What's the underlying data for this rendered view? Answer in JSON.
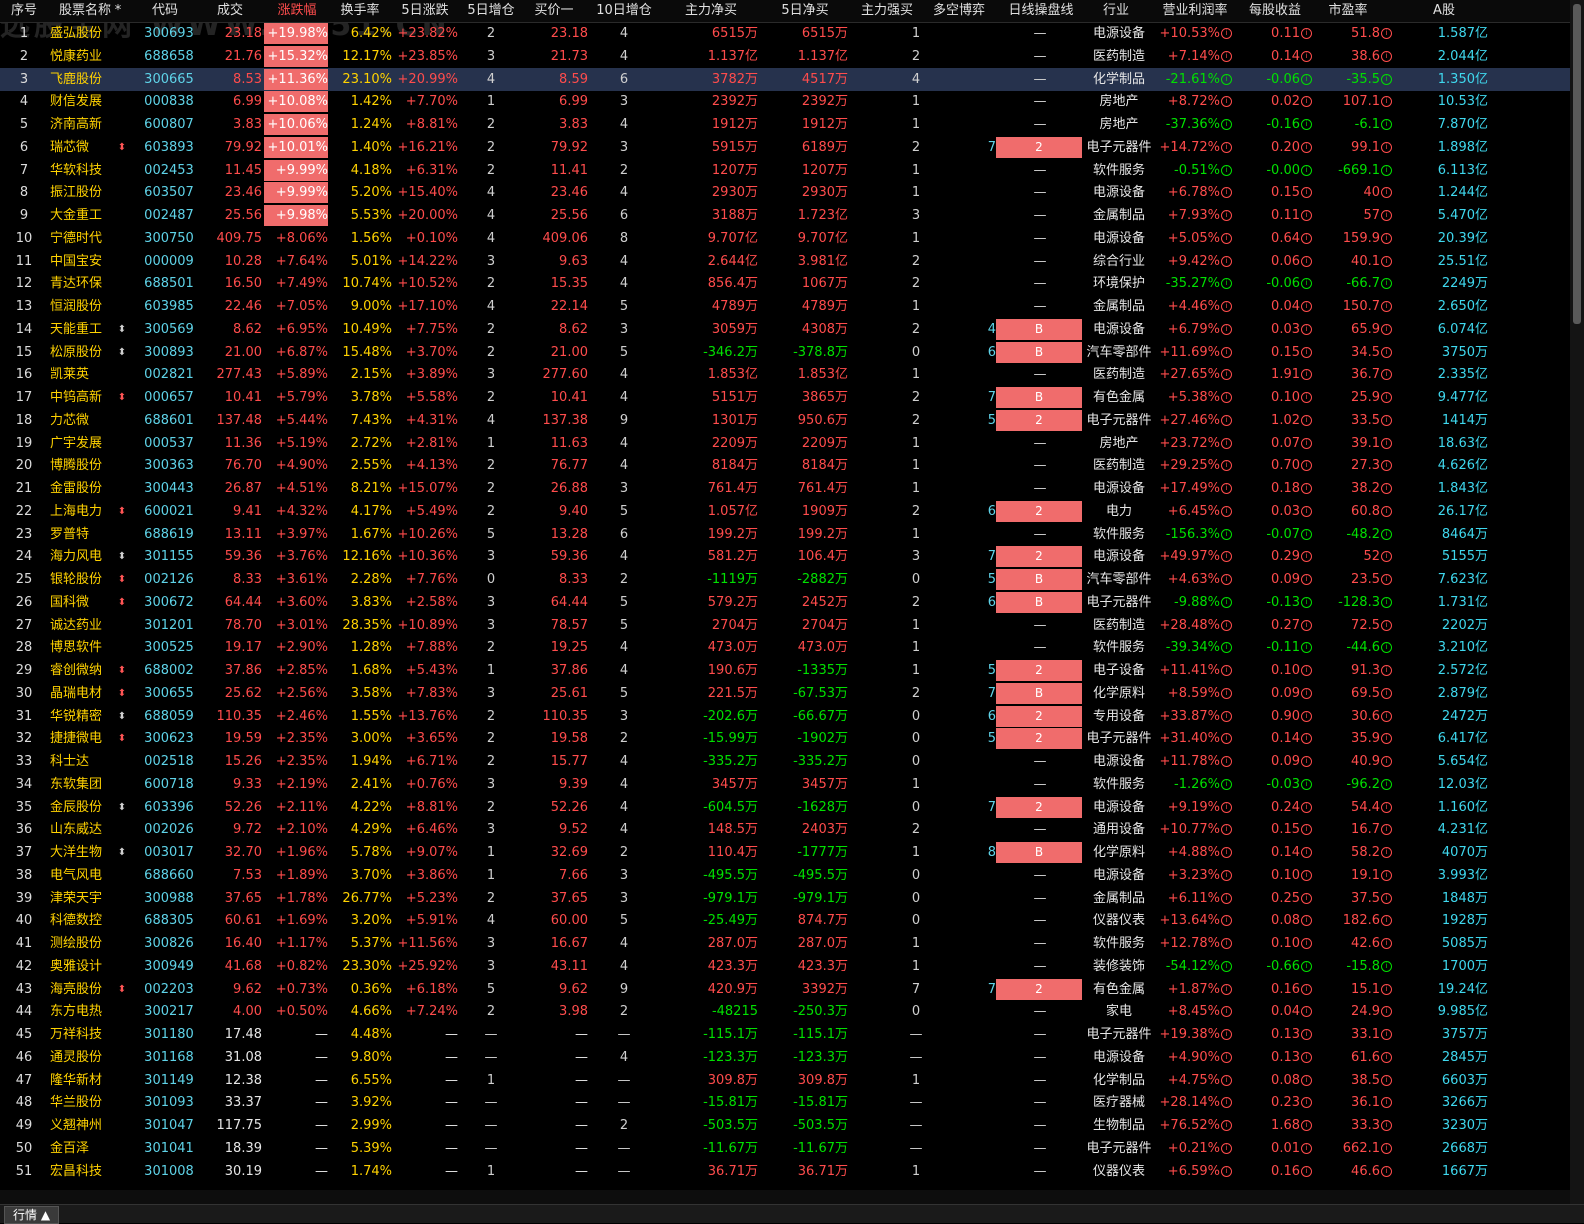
{
  "watermark": "选股宝网 WWW.XG51.CN",
  "tab_label": "行情 ▲",
  "sorted_column": "涨跌幅",
  "headers": [
    "序号",
    "股票名称",
    "*",
    "代码",
    "成交",
    "涨跌幅",
    "换手率",
    "5日涨跌",
    "5日增仓",
    "买价一",
    "10日增仓",
    "主力净买",
    "5日净买",
    "主力强买",
    "多空博弈",
    "日线操盘线",
    "行业",
    "营业利润率",
    "每股收益",
    "市盈率",
    "A股"
  ],
  "rows": [
    [
      "1",
      "盛弘股份",
      "",
      "300693",
      "23.18",
      "+19.98%",
      "6.42%",
      "+23.82%",
      "2",
      "23.18",
      "4",
      "6515万",
      "6515万",
      "1",
      "",
      "",
      "—",
      "电源设备",
      "+10.53%",
      "0.11",
      "51.8",
      "1.587亿"
    ],
    [
      "2",
      "悦康药业",
      "",
      "688658",
      "21.76",
      "+15.32%",
      "12.17%",
      "+23.85%",
      "3",
      "21.73",
      "4",
      "1.137亿",
      "1.137亿",
      "2",
      "",
      "",
      "—",
      "医药制造",
      "+7.14%",
      "0.14",
      "38.6",
      "2.044亿"
    ],
    [
      "3",
      "飞鹿股份",
      "",
      "300665",
      "8.53",
      "+11.36%",
      "23.10%",
      "+20.99%",
      "4",
      "8.59",
      "6",
      "3782万",
      "4517万",
      "4",
      "",
      "",
      "—",
      "化学制品",
      "-21.61%",
      "-0.06",
      "-35.5",
      "1.350亿"
    ],
    [
      "4",
      "财信发展",
      "",
      "000838",
      "6.99",
      "+10.08%",
      "1.42%",
      "+7.70%",
      "1",
      "6.99",
      "3",
      "2392万",
      "2392万",
      "1",
      "",
      "",
      "—",
      "房地产",
      "+8.72%",
      "0.02",
      "107.1",
      "10.53亿"
    ],
    [
      "5",
      "济南高新",
      "",
      "600807",
      "3.83",
      "+10.06%",
      "1.24%",
      "+8.81%",
      "2",
      "3.83",
      "4",
      "1912万",
      "1912万",
      "1",
      "",
      "",
      "—",
      "房地产",
      "-37.36%",
      "-0.16",
      "-6.1",
      "7.870亿"
    ],
    [
      "6",
      "瑞芯微",
      "r",
      "603893",
      "79.92",
      "+10.01%",
      "1.40%",
      "+16.21%",
      "2",
      "79.92",
      "3",
      "5915万",
      "6189万",
      "2",
      "7",
      "2",
      "",
      "电子元器件",
      "+14.72%",
      "0.20",
      "99.1",
      "1.898亿"
    ],
    [
      "7",
      "华软科技",
      "",
      "002453",
      "11.45",
      "+9.99%",
      "4.18%",
      "+6.31%",
      "2",
      "11.41",
      "2",
      "1207万",
      "1207万",
      "1",
      "",
      "",
      "—",
      "软件服务",
      "-0.51%",
      "-0.00",
      "-669.1",
      "6.113亿"
    ],
    [
      "8",
      "振江股份",
      "",
      "603507",
      "23.46",
      "+9.99%",
      "5.20%",
      "+15.40%",
      "4",
      "23.46",
      "4",
      "2930万",
      "2930万",
      "1",
      "",
      "",
      "—",
      "电源设备",
      "+6.78%",
      "0.15",
      "40",
      "1.244亿"
    ],
    [
      "9",
      "大金重工",
      "",
      "002487",
      "25.56",
      "+9.98%",
      "5.53%",
      "+20.00%",
      "4",
      "25.56",
      "6",
      "3188万",
      "1.723亿",
      "3",
      "",
      "",
      "—",
      "金属制品",
      "+7.93%",
      "0.11",
      "57",
      "5.470亿"
    ],
    [
      "10",
      "宁德时代",
      "",
      "300750",
      "409.75",
      "+8.06%",
      "1.56%",
      "+0.10%",
      "4",
      "409.06",
      "8",
      "9.707亿",
      "9.707亿",
      "1",
      "",
      "",
      "—",
      "电源设备",
      "+5.05%",
      "0.64",
      "159.9",
      "20.39亿"
    ],
    [
      "11",
      "中国宝安",
      "",
      "000009",
      "10.28",
      "+7.64%",
      "5.01%",
      "+14.22%",
      "3",
      "9.63",
      "4",
      "2.644亿",
      "3.981亿",
      "2",
      "",
      "",
      "—",
      "综合行业",
      "+9.42%",
      "0.06",
      "40.1",
      "25.51亿"
    ],
    [
      "12",
      "青达环保",
      "",
      "688501",
      "16.50",
      "+7.49%",
      "10.74%",
      "+10.52%",
      "2",
      "15.35",
      "4",
      "856.4万",
      "1067万",
      "2",
      "",
      "",
      "—",
      "环境保护",
      "-35.27%",
      "-0.06",
      "-66.7",
      "2249万"
    ],
    [
      "13",
      "恒润股份",
      "",
      "603985",
      "22.46",
      "+7.05%",
      "9.00%",
      "+17.10%",
      "4",
      "22.14",
      "5",
      "4789万",
      "4789万",
      "1",
      "",
      "",
      "—",
      "金属制品",
      "+4.46%",
      "0.04",
      "150.7",
      "2.650亿"
    ],
    [
      "14",
      "天能重工",
      "w",
      "300569",
      "8.62",
      "+6.95%",
      "10.49%",
      "+7.75%",
      "2",
      "8.62",
      "3",
      "3059万",
      "4308万",
      "2",
      "4",
      "B",
      "",
      "电源设备",
      "+6.79%",
      "0.03",
      "65.9",
      "6.074亿"
    ],
    [
      "15",
      "松原股份",
      "w",
      "300893",
      "21.00",
      "+6.87%",
      "15.48%",
      "+3.70%",
      "2",
      "21.00",
      "5",
      "-346.2万",
      "-378.8万",
      "0",
      "6",
      "B",
      "",
      "汽车零部件",
      "+11.69%",
      "0.15",
      "34.5",
      "3750万"
    ],
    [
      "16",
      "凯莱英",
      "",
      "002821",
      "277.43",
      "+5.89%",
      "2.15%",
      "+3.89%",
      "3",
      "277.60",
      "4",
      "1.853亿",
      "1.853亿",
      "1",
      "",
      "",
      "—",
      "医药制造",
      "+27.65%",
      "1.91",
      "36.7",
      "2.335亿"
    ],
    [
      "17",
      "中钨高新",
      "r",
      "000657",
      "10.41",
      "+5.79%",
      "3.78%",
      "+5.58%",
      "2",
      "10.41",
      "4",
      "5151万",
      "3865万",
      "2",
      "7",
      "B",
      "",
      "有色金属",
      "+5.38%",
      "0.10",
      "25.9",
      "9.477亿"
    ],
    [
      "18",
      "力芯微",
      "",
      "688601",
      "137.48",
      "+5.44%",
      "7.43%",
      "+4.31%",
      "4",
      "137.38",
      "9",
      "1301万",
      "950.6万",
      "2",
      "5",
      "2",
      "",
      "电子元器件",
      "+27.46%",
      "1.02",
      "33.5",
      "1414万"
    ],
    [
      "19",
      "广宇发展",
      "",
      "000537",
      "11.36",
      "+5.19%",
      "2.72%",
      "+2.81%",
      "1",
      "11.63",
      "4",
      "2209万",
      "2209万",
      "1",
      "",
      "",
      "—",
      "房地产",
      "+23.72%",
      "0.07",
      "39.1",
      "18.63亿"
    ],
    [
      "20",
      "博腾股份",
      "",
      "300363",
      "76.70",
      "+4.90%",
      "2.55%",
      "+4.13%",
      "2",
      "76.77",
      "4",
      "8184万",
      "8184万",
      "1",
      "",
      "",
      "—",
      "医药制造",
      "+29.25%",
      "0.70",
      "27.3",
      "4.626亿"
    ],
    [
      "21",
      "金雷股份",
      "",
      "300443",
      "26.87",
      "+4.51%",
      "8.21%",
      "+15.07%",
      "2",
      "26.88",
      "3",
      "761.4万",
      "761.4万",
      "1",
      "",
      "",
      "—",
      "电源设备",
      "+17.49%",
      "0.18",
      "38.2",
      "1.843亿"
    ],
    [
      "22",
      "上海电力",
      "r",
      "600021",
      "9.41",
      "+4.32%",
      "4.17%",
      "+5.49%",
      "2",
      "9.40",
      "5",
      "1.057亿",
      "1909万",
      "2",
      "6",
      "2",
      "",
      "电力",
      "+6.45%",
      "0.03",
      "60.8",
      "26.17亿"
    ],
    [
      "23",
      "罗普特",
      "",
      "688619",
      "13.11",
      "+3.97%",
      "1.67%",
      "+10.26%",
      "5",
      "13.28",
      "6",
      "199.2万",
      "199.2万",
      "1",
      "",
      "",
      "—",
      "软件服务",
      "-156.3%",
      "-0.07",
      "-48.2",
      "8464万"
    ],
    [
      "24",
      "海力风电",
      "w",
      "301155",
      "59.36",
      "+3.76%",
      "12.16%",
      "+10.36%",
      "3",
      "59.36",
      "4",
      "581.2万",
      "106.4万",
      "3",
      "7",
      "2",
      "",
      "电源设备",
      "+49.97%",
      "0.29",
      "52",
      "5155万"
    ],
    [
      "25",
      "银轮股份",
      "r",
      "002126",
      "8.33",
      "+3.61%",
      "2.28%",
      "+7.76%",
      "0",
      "8.33",
      "2",
      "-1119万",
      "-2882万",
      "0",
      "5",
      "B",
      "",
      "汽车零部件",
      "+4.63%",
      "0.09",
      "23.5",
      "7.623亿"
    ],
    [
      "26",
      "国科微",
      "r",
      "300672",
      "64.44",
      "+3.60%",
      "3.83%",
      "+2.58%",
      "3",
      "64.44",
      "5",
      "579.2万",
      "2452万",
      "2",
      "6",
      "B",
      "",
      "电子元器件",
      "-9.88%",
      "-0.13",
      "-128.3",
      "1.731亿"
    ],
    [
      "27",
      "诚达药业",
      "",
      "301201",
      "78.70",
      "+3.01%",
      "28.35%",
      "+10.89%",
      "3",
      "78.57",
      "5",
      "2704万",
      "2704万",
      "1",
      "",
      "",
      "—",
      "医药制造",
      "+28.48%",
      "0.27",
      "72.5",
      "2202万"
    ],
    [
      "28",
      "博思软件",
      "",
      "300525",
      "19.17",
      "+2.90%",
      "1.28%",
      "+7.88%",
      "2",
      "19.25",
      "4",
      "473.0万",
      "473.0万",
      "1",
      "",
      "",
      "—",
      "软件服务",
      "-39.34%",
      "-0.11",
      "-44.6",
      "3.210亿"
    ],
    [
      "29",
      "睿创微纳",
      "r",
      "688002",
      "37.86",
      "+2.85%",
      "1.68%",
      "+5.43%",
      "1",
      "37.86",
      "4",
      "190.6万",
      "-1335万",
      "1",
      "5",
      "2",
      "",
      "电子设备",
      "+11.41%",
      "0.10",
      "91.3",
      "2.572亿"
    ],
    [
      "30",
      "晶瑞电材",
      "r",
      "300655",
      "25.62",
      "+2.56%",
      "3.58%",
      "+7.83%",
      "3",
      "25.61",
      "5",
      "221.5万",
      "-67.53万",
      "2",
      "7",
      "B",
      "",
      "化学原料",
      "+8.59%",
      "0.09",
      "69.5",
      "2.879亿"
    ],
    [
      "31",
      "华锐精密",
      "w",
      "688059",
      "110.35",
      "+2.46%",
      "1.55%",
      "+13.76%",
      "2",
      "110.35",
      "3",
      "-202.6万",
      "-66.67万",
      "0",
      "6",
      "2",
      "",
      "专用设备",
      "+33.87%",
      "0.90",
      "30.6",
      "2472万"
    ],
    [
      "32",
      "捷捷微电",
      "r",
      "300623",
      "19.59",
      "+2.35%",
      "3.00%",
      "+3.65%",
      "2",
      "19.58",
      "2",
      "-15.99万",
      "-1902万",
      "0",
      "5",
      "2",
      "",
      "电子元器件",
      "+31.40%",
      "0.14",
      "35.9",
      "6.417亿"
    ],
    [
      "33",
      "科士达",
      "",
      "002518",
      "15.26",
      "+2.35%",
      "1.94%",
      "+6.71%",
      "2",
      "15.77",
      "4",
      "-335.2万",
      "-335.2万",
      "0",
      "",
      "",
      "—",
      "电源设备",
      "+11.78%",
      "0.09",
      "40.9",
      "5.654亿"
    ],
    [
      "34",
      "东软集团",
      "",
      "600718",
      "9.33",
      "+2.19%",
      "2.41%",
      "+0.76%",
      "3",
      "9.39",
      "4",
      "3457万",
      "3457万",
      "1",
      "",
      "",
      "—",
      "软件服务",
      "-1.26%",
      "-0.03",
      "-96.2",
      "12.03亿"
    ],
    [
      "35",
      "金辰股份",
      "w",
      "603396",
      "52.26",
      "+2.11%",
      "4.22%",
      "+8.81%",
      "2",
      "52.26",
      "4",
      "-604.5万",
      "-1628万",
      "0",
      "7",
      "2",
      "",
      "电源设备",
      "+9.19%",
      "0.24",
      "54.4",
      "1.160亿"
    ],
    [
      "36",
      "山东威达",
      "",
      "002026",
      "9.72",
      "+2.10%",
      "4.29%",
      "+6.46%",
      "3",
      "9.52",
      "4",
      "148.5万",
      "2403万",
      "2",
      "",
      "",
      "—",
      "通用设备",
      "+10.77%",
      "0.15",
      "16.7",
      "4.231亿"
    ],
    [
      "37",
      "大洋生物",
      "w",
      "003017",
      "32.70",
      "+1.96%",
      "5.78%",
      "+9.07%",
      "1",
      "32.69",
      "2",
      "110.4万",
      "-1777万",
      "1",
      "8",
      "B",
      "",
      "化学原料",
      "+4.88%",
      "0.14",
      "58.2",
      "4070万"
    ],
    [
      "38",
      "电气风电",
      "",
      "688660",
      "7.53",
      "+1.89%",
      "3.70%",
      "+3.86%",
      "1",
      "7.66",
      "3",
      "-495.5万",
      "-495.5万",
      "0",
      "",
      "",
      "—",
      "电源设备",
      "+3.23%",
      "0.10",
      "19.1",
      "3.993亿"
    ],
    [
      "39",
      "津荣天宇",
      "",
      "300988",
      "37.65",
      "+1.78%",
      "26.77%",
      "+5.23%",
      "2",
      "37.65",
      "3",
      "-979.1万",
      "-979.1万",
      "0",
      "",
      "",
      "—",
      "金属制品",
      "+6.11%",
      "0.25",
      "37.5",
      "1848万"
    ],
    [
      "40",
      "科德数控",
      "",
      "688305",
      "60.61",
      "+1.69%",
      "3.20%",
      "+5.91%",
      "4",
      "60.00",
      "5",
      "-25.49万",
      "874.7万",
      "0",
      "",
      "",
      "—",
      "仪器仪表",
      "+13.64%",
      "0.08",
      "182.6",
      "1928万"
    ],
    [
      "41",
      "测绘股份",
      "",
      "300826",
      "16.40",
      "+1.17%",
      "5.37%",
      "+11.56%",
      "3",
      "16.67",
      "4",
      "287.0万",
      "287.0万",
      "1",
      "",
      "",
      "—",
      "软件服务",
      "+12.78%",
      "0.10",
      "42.6",
      "5085万"
    ],
    [
      "42",
      "奥雅设计",
      "",
      "300949",
      "41.68",
      "+0.82%",
      "23.30%",
      "+25.92%",
      "3",
      "43.11",
      "4",
      "423.3万",
      "423.3万",
      "1",
      "",
      "",
      "—",
      "装修装饰",
      "-54.12%",
      "-0.66",
      "-15.8",
      "1700万"
    ],
    [
      "43",
      "海亮股份",
      "r",
      "002203",
      "9.62",
      "+0.73%",
      "0.36%",
      "+6.18%",
      "5",
      "9.62",
      "9",
      "420.9万",
      "3392万",
      "7",
      "7",
      "2",
      "",
      "有色金属",
      "+1.87%",
      "0.16",
      "15.1",
      "19.24亿"
    ],
    [
      "44",
      "东方电热",
      "",
      "300217",
      "4.00",
      "+0.50%",
      "4.66%",
      "+7.24%",
      "2",
      "3.98",
      "2",
      "-48215",
      "-250.3万",
      "0",
      "",
      "",
      "—",
      "家电",
      "+8.45%",
      "0.04",
      "24.9",
      "9.985亿"
    ],
    [
      "45",
      "万祥科技",
      "",
      "301180",
      "17.48",
      "—",
      "4.48%",
      "—",
      "—",
      "—",
      "—",
      "-115.1万",
      "-115.1万",
      "—",
      "",
      "",
      "—",
      "电子元器件",
      "+19.38%",
      "0.13",
      "33.1",
      "3757万"
    ],
    [
      "46",
      "通灵股份",
      "",
      "301168",
      "31.08",
      "—",
      "9.80%",
      "—",
      "—",
      "—",
      "4",
      "-123.3万",
      "-123.3万",
      "—",
      "",
      "",
      "—",
      "电源设备",
      "+4.90%",
      "0.13",
      "61.6",
      "2845万"
    ],
    [
      "47",
      "隆华新材",
      "",
      "301149",
      "12.38",
      "—",
      "6.55%",
      "—",
      "1",
      "—",
      "—",
      "309.8万",
      "309.8万",
      "1",
      "",
      "",
      "—",
      "化学制品",
      "+4.75%",
      "0.08",
      "38.5",
      "6603万"
    ],
    [
      "48",
      "华兰股份",
      "",
      "301093",
      "33.37",
      "—",
      "3.92%",
      "—",
      "—",
      "—",
      "—",
      "-15.81万",
      "-15.81万",
      "—",
      "",
      "",
      "—",
      "医疗器械",
      "+28.14%",
      "0.23",
      "36.1",
      "3266万"
    ],
    [
      "49",
      "义翘神州",
      "",
      "301047",
      "117.75",
      "—",
      "2.99%",
      "—",
      "—",
      "—",
      "2",
      "-503.5万",
      "-503.5万",
      "—",
      "",
      "",
      "—",
      "生物制品",
      "+76.52%",
      "1.68",
      "33.3",
      "3230万"
    ],
    [
      "50",
      "金百泽",
      "",
      "301041",
      "18.39",
      "—",
      "5.39%",
      "—",
      "—",
      "—",
      "—",
      "-11.67万",
      "-11.67万",
      "—",
      "",
      "",
      "—",
      "电子元器件",
      "+0.21%",
      "0.01",
      "662.1",
      "2668万"
    ],
    [
      "51",
      "宏昌科技",
      "",
      "301008",
      "30.19",
      "—",
      "1.74%",
      "—",
      "1",
      "—",
      "—",
      "36.71万",
      "36.71万",
      "1",
      "",
      "",
      "—",
      "仪器仪表",
      "+6.59%",
      "0.16",
      "46.6",
      "1667万"
    ]
  ]
}
